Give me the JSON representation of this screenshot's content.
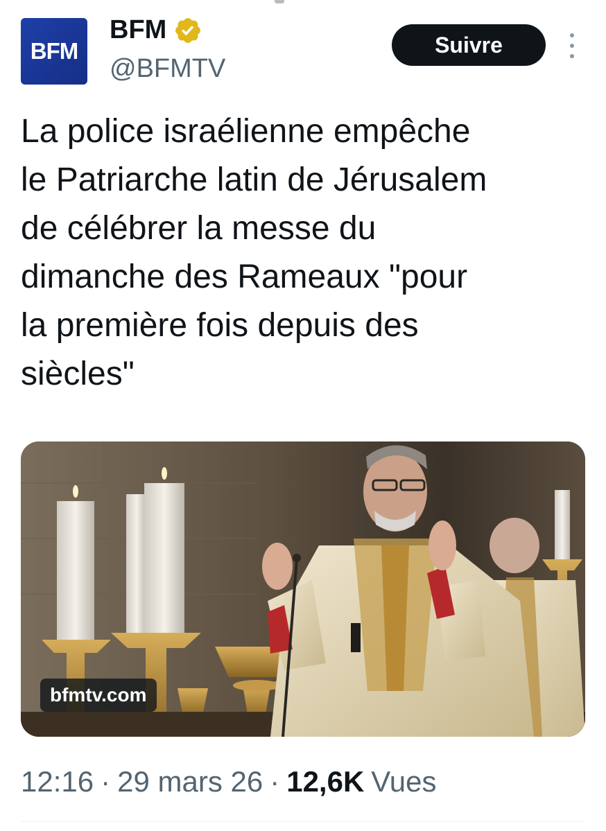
{
  "author": {
    "avatar_text": "BFM",
    "display_name": "BFM",
    "handle": "@BFMTV",
    "verified_badge_color": "#e2b719",
    "avatar_color": "#1f3fa8"
  },
  "actions": {
    "follow_label": "Suivre",
    "more_icon": "more-vertical-icon"
  },
  "tweet": {
    "text": "La police israélienne empêche\nle Patriarche latin de Jérusalem\nde célébrer la messe du\ndimanche des Rameaux \"pour\nla première fois depuis des\nsiècles\""
  },
  "media": {
    "link_label": "bfmtv.com"
  },
  "meta": {
    "time": "12:16",
    "separator": "·",
    "date": "29 mars 26",
    "views_count": "12,6K",
    "views_label": "Vues"
  },
  "colors": {
    "text_primary": "#0f1419",
    "text_secondary": "#536471",
    "button_bg": "#0f1419"
  }
}
